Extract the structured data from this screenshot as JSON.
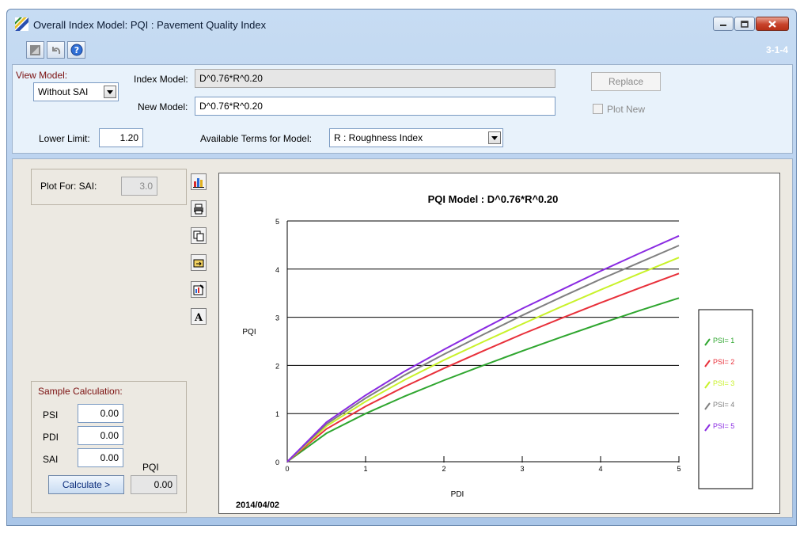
{
  "window": {
    "title": "Overall Index Model: PQI  :  Pavement Quality Index",
    "form_code": "3-1-4"
  },
  "top": {
    "view_model_label": "View Model:",
    "view_model_value": "Without SAI",
    "index_model_label": "Index Model:",
    "index_model_value": "D^0.76*R^0.20",
    "new_model_label": "New Model:",
    "new_model_value": "D^0.76*R^0.20",
    "replace_label": "Replace",
    "plot_new_label": "Plot New",
    "lower_limit_label": "Lower Limit:",
    "lower_limit_value": "1.20",
    "available_terms_label": "Available Terms for Model:",
    "available_terms_value": "R  :  Roughness Index"
  },
  "plot_for": {
    "label": "Plot For:  SAI:",
    "value": "3.0"
  },
  "sample": {
    "title": "Sample Calculation:",
    "psi_label": "PSI",
    "psi_value": "0.00",
    "pdi_label": "PDI",
    "pdi_value": "0.00",
    "sai_label": "SAI",
    "sai_value": "0.00",
    "pqi_label": "PQI",
    "pqi_value": "0.00",
    "calculate_label": "Calculate >"
  },
  "colors": {
    "psi1": "#2fa62f",
    "psi2": "#e8303a",
    "psi3": "#c9f22a",
    "psi4": "#808080",
    "psi5": "#8a2be2"
  },
  "chart_data": {
    "type": "line",
    "title": "PQI Model : D^0.76*R^0.20",
    "xlabel": "PDI",
    "ylabel": "PQI",
    "date_label": "2014/04/02",
    "xlim": [
      0,
      5
    ],
    "ylim": [
      0,
      5
    ],
    "xticks": [
      "0",
      "1",
      "2",
      "3",
      "4",
      "5"
    ],
    "yticks": [
      "0",
      "1",
      "2",
      "3",
      "4",
      "5"
    ],
    "grid": "horizontal",
    "legend_position": "right",
    "x": [
      0,
      0.5,
      1,
      1.5,
      2,
      2.5,
      3,
      3.5,
      4,
      4.5,
      5
    ],
    "series": [
      {
        "name": "PSI= 1",
        "color_key": "psi1",
        "values": [
          0,
          0.59,
          1.0,
          1.36,
          1.69,
          2.0,
          2.3,
          2.59,
          2.87,
          3.14,
          3.4
        ]
      },
      {
        "name": "PSI= 2",
        "color_key": "psi2",
        "values": [
          0,
          0.68,
          1.15,
          1.56,
          1.94,
          2.3,
          2.65,
          2.98,
          3.3,
          3.61,
          3.91
        ]
      },
      {
        "name": "PSI= 3",
        "color_key": "psi3",
        "values": [
          0,
          0.74,
          1.25,
          1.7,
          2.11,
          2.49,
          2.86,
          3.22,
          3.57,
          3.91,
          4.24
        ]
      },
      {
        "name": "PSI= 4",
        "color_key": "psi4",
        "values": [
          0,
          0.78,
          1.32,
          1.8,
          2.23,
          2.64,
          3.04,
          3.42,
          3.79,
          4.14,
          4.49
        ]
      },
      {
        "name": "PSI= 5",
        "color_key": "psi5",
        "values": [
          0,
          0.82,
          1.38,
          1.88,
          2.33,
          2.76,
          3.18,
          3.57,
          3.96,
          4.33,
          4.69
        ]
      }
    ]
  }
}
